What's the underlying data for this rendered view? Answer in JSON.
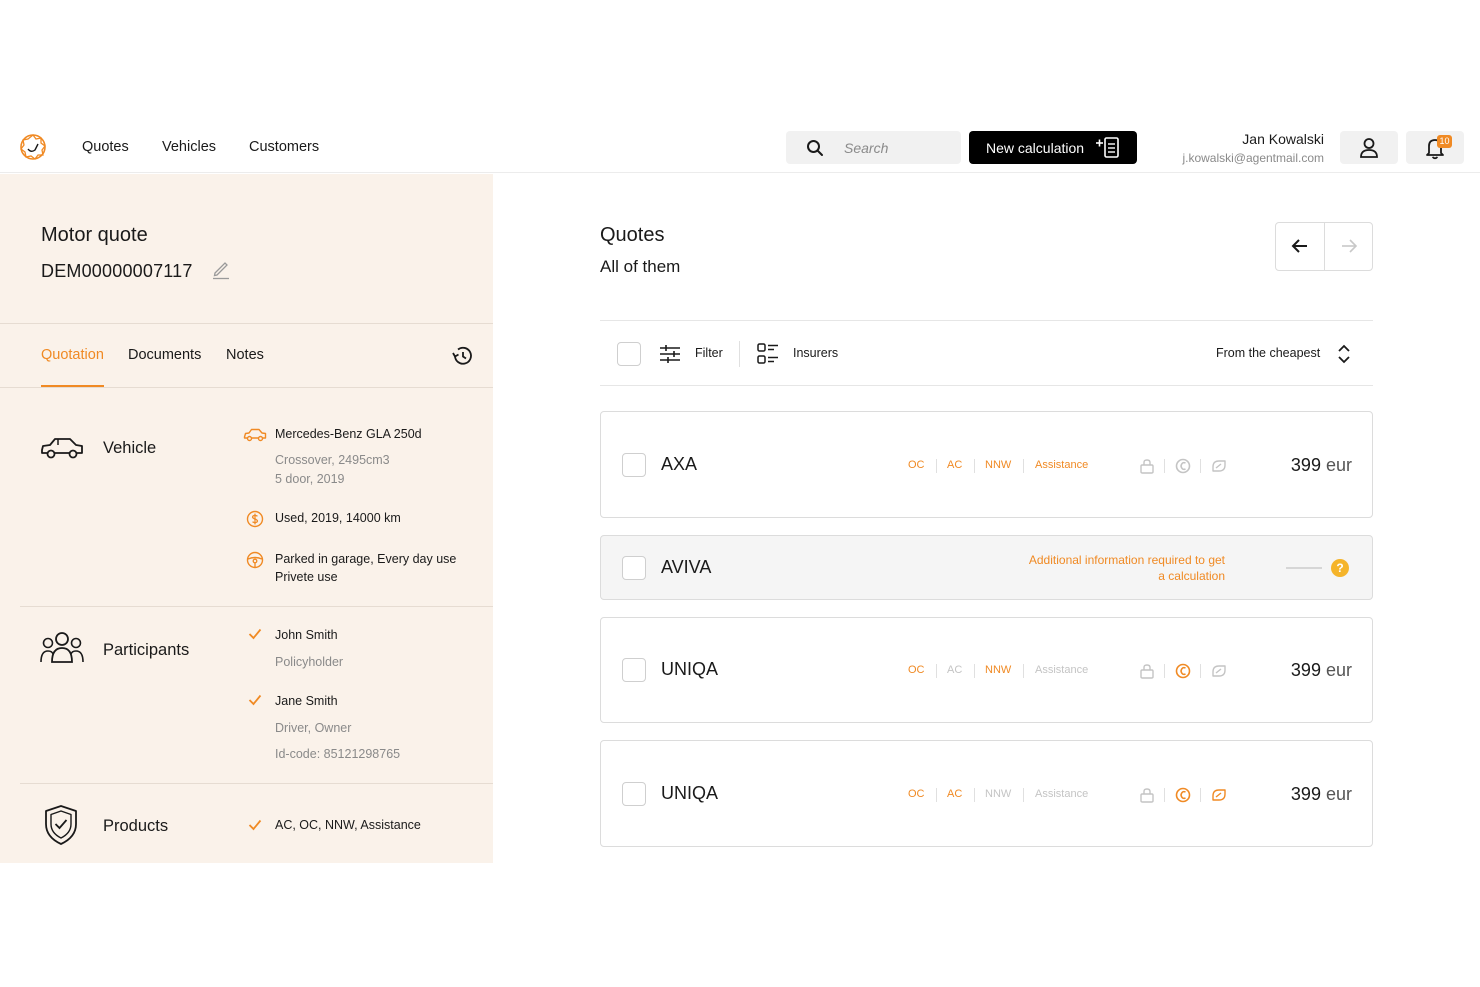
{
  "colors": {
    "accent": "#f08a24",
    "panel_bg": "#faf2ea",
    "help": "#f5b42a"
  },
  "nav": {
    "links": [
      "Quotes",
      "Vehicles",
      "Customers"
    ]
  },
  "search": {
    "placeholder": "Search"
  },
  "new_calculation": {
    "label": "New calculation"
  },
  "user": {
    "name": "Jan Kowalski",
    "email": "j.kowalski@agentmail.com",
    "notifications": "10"
  },
  "quote": {
    "title": "Motor quote",
    "id": "DEM00000007117"
  },
  "tabs": [
    {
      "label": "Quotation",
      "active": true
    },
    {
      "label": "Documents",
      "active": false
    },
    {
      "label": "Notes",
      "active": false
    }
  ],
  "vehicle": {
    "label": "Vehicle",
    "model": "Mercedes-Benz GLA 250d",
    "spec_line1": "Crossover, 2495cm3",
    "spec_line2": "5 door, 2019",
    "condition": "Used, 2019, 14000 km",
    "usage_line1": "Parked in garage, Every day use",
    "usage_line2": "Privete use"
  },
  "participants": {
    "label": "Participants",
    "people": [
      {
        "name": "John Smith",
        "role": "Policyholder"
      },
      {
        "name": "Jane Smith",
        "role": "Driver, Owner",
        "extra": "Id-code: 85121298765"
      }
    ]
  },
  "products": {
    "label": "Products",
    "value": "AC, OC, NNW, Assistance"
  },
  "quotes": {
    "title": "Quotes",
    "subtitle": "All of them",
    "filter_label": "Filter",
    "insurers_label": "Insurers",
    "sort_label": "From the cheapest",
    "coverages": [
      "OC",
      "AC",
      "NNW",
      "Assistance"
    ],
    "items": [
      {
        "name": "AXA",
        "coverage_on": [
          true,
          true,
          true,
          true
        ],
        "features_on": [
          false,
          false,
          false
        ],
        "price": "399",
        "unit": "eur"
      },
      {
        "name": "AVIVA",
        "info": "Additional information required to get a calculation",
        "info_line1": "Additional information required to get",
        "info_line2": "a calculation",
        "help": "?"
      },
      {
        "name": "UNIQA",
        "coverage_on": [
          true,
          false,
          true,
          false
        ],
        "features_on": [
          false,
          true,
          false
        ],
        "price": "399",
        "unit": "eur"
      },
      {
        "name": "UNIQA",
        "coverage_on": [
          true,
          true,
          false,
          false
        ],
        "features_on": [
          false,
          true,
          true
        ],
        "price": "399",
        "unit": "eur"
      }
    ]
  }
}
